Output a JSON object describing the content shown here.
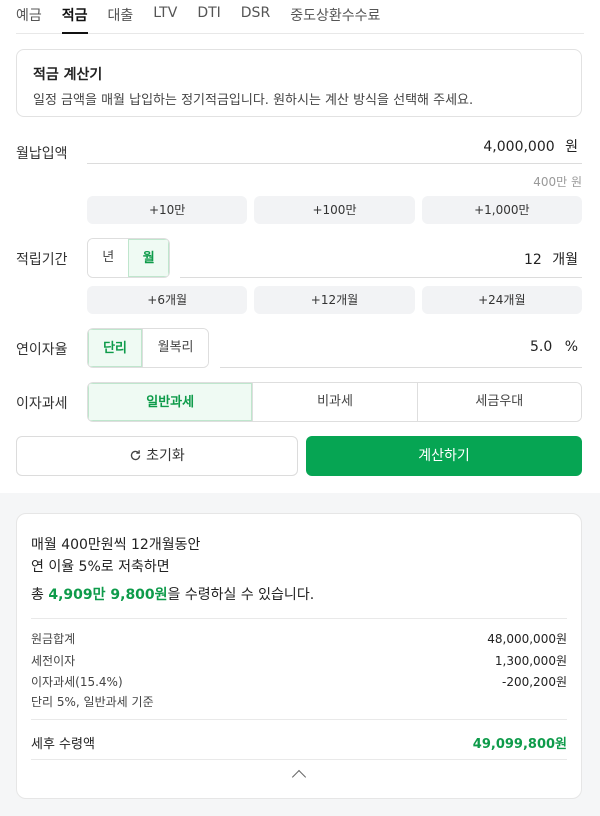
{
  "tabs": [
    {
      "label": "예금",
      "active": false
    },
    {
      "label": "적금",
      "active": true
    },
    {
      "label": "대출",
      "active": false
    },
    {
      "label": "LTV",
      "active": false
    },
    {
      "label": "DTI",
      "active": false
    },
    {
      "label": "DSR",
      "active": false
    },
    {
      "label": "중도상환수수료",
      "active": false
    }
  ],
  "info": {
    "title": "적금 계산기",
    "description": "일정 금액을 매월 납입하는 정기적금입니다. 원하시는 계산 방식을 선택해 주세요."
  },
  "monthly": {
    "label": "월납입액",
    "value": "4,000,000",
    "unit": "원",
    "hint": "400만 원",
    "chips": [
      "+10만",
      "+100만",
      "+1,000만"
    ]
  },
  "period": {
    "label": "적립기간",
    "options": [
      "년",
      "월"
    ],
    "selected": "월",
    "value": "12",
    "unit": "개월",
    "chips": [
      "+6개월",
      "+12개월",
      "+24개월"
    ]
  },
  "rate": {
    "label": "연이자율",
    "options": [
      "단리",
      "월복리"
    ],
    "selected": "단리",
    "value": "5.0",
    "unit": "%"
  },
  "tax": {
    "label": "이자과세",
    "options": [
      "일반과세",
      "비과세",
      "세금우대"
    ],
    "selected": "일반과세"
  },
  "buttons": {
    "reset": "초기화",
    "calculate": "계산하기"
  },
  "result": {
    "line1": "매월 400만원씩 12개월동안",
    "line2": "연 이율 5%로 저축하면",
    "line3_prefix": "총 ",
    "line3_amount": "4,909만 9,800원",
    "line3_suffix": "을 수령하실 수 있습니다.",
    "rows": [
      {
        "label": "원금합계",
        "value": "48,000,000원"
      },
      {
        "label": "세전이자",
        "value": "1,300,000원"
      },
      {
        "label": "이자과세(15.4%)",
        "value": "-200,200원"
      }
    ],
    "note": "단리 5%, 일반과세 기준",
    "net_label": "세후 수령액",
    "net_value": "49,099,800원"
  },
  "colors": {
    "accent": "#06a553",
    "accent_text": "#0e9b4a"
  }
}
